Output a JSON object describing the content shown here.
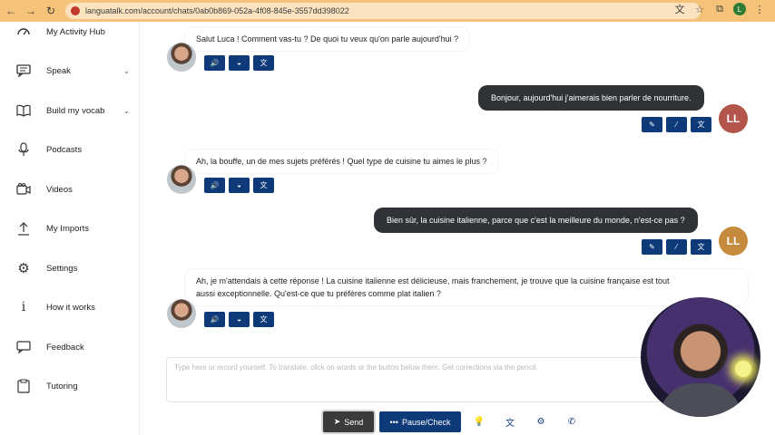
{
  "browser": {
    "url": "languatalk.com/account/chats/0ab0b869-052a-4f08-845e-3557dd398022",
    "profile_initial": "L"
  },
  "sidebar": {
    "items": [
      {
        "label": "My Activity Hub",
        "icon": "activity-icon"
      },
      {
        "label": "Speak",
        "icon": "chat-icon",
        "caret": "⌄"
      },
      {
        "label": "Build my vocab",
        "icon": "book-icon",
        "caret": "⌄"
      },
      {
        "label": "Podcasts",
        "icon": "microphone-icon"
      },
      {
        "label": "Videos",
        "icon": "video-icon"
      },
      {
        "label": "My Imports",
        "icon": "upload-icon"
      },
      {
        "label": "Settings",
        "icon": "gear-icon"
      },
      {
        "label": "How it works",
        "icon": "info-icon"
      },
      {
        "label": "Feedback",
        "icon": "feedback-icon"
      },
      {
        "label": "Tutoring",
        "icon": "clipboard-icon"
      }
    ]
  },
  "chat": {
    "messages": [
      {
        "role": "ai",
        "text": "Salut Luca ! Comment vas-tu ? De quoi tu veux qu'on parle aujourd'hui ?"
      },
      {
        "role": "user",
        "text": "Bonjour, aujourd'hui j'aimerais bien parler de nourriture.",
        "initials": "LL"
      },
      {
        "role": "ai",
        "text": "Ah, la bouffe, un de mes sujets préférés ! Quel type de cuisine tu aimes le plus ?"
      },
      {
        "role": "user",
        "text": "Bien sûr, la cuisine italienne, parce que c'est la meilleure du monde, n'est-ce pas ?",
        "initials": "LL"
      },
      {
        "role": "ai",
        "text_line1": "Ah, je m'attendais à cette réponse ! La cuisine italienne est délicieuse, mais franchement, je trouve que la cuisine française est tout",
        "text_line2": "aussi exceptionnelle. Qu'est-ce que tu préfères comme plat italien ?"
      }
    ],
    "user_avatar_color_1": "#b5544a",
    "user_avatar_color_2": "#c58a3c"
  },
  "input": {
    "placeholder": "Type here or record yourself. To translate, click on words or the button below them. Get corrections via the pencil."
  },
  "toolbar": {
    "send_label": "Send",
    "pause_label": "Pause/Check"
  },
  "colors": {
    "accent": "#0e3a7a",
    "user_bubble": "#2f3338"
  }
}
